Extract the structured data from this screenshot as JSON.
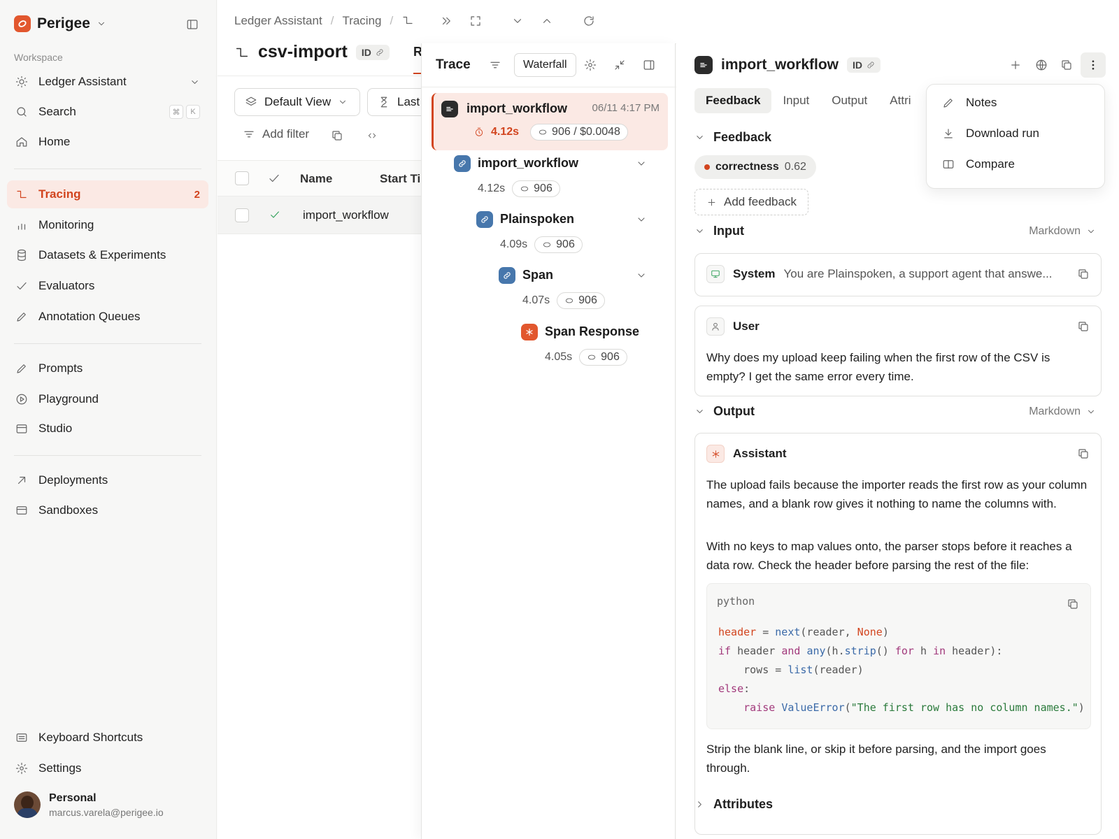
{
  "sidebar": {
    "brand": "Perigee",
    "workspace_label": "Workspace",
    "workspace_name": "Ledger Assistant",
    "search": "Search",
    "kbd": [
      "⌘",
      "K"
    ],
    "home": "Home",
    "tracing": "Tracing",
    "tracing_count": "2",
    "monitoring": "Monitoring",
    "datasets": "Datasets & Experiments",
    "evaluators": "Evaluators",
    "annotation": "Annotation Queues",
    "prompts": "Prompts",
    "playground": "Playground",
    "studio": "Studio",
    "deployments": "Deployments",
    "sandboxes": "Sandboxes",
    "shortcuts": "Keyboard Shortcuts",
    "settings": "Settings",
    "user_name": "Personal",
    "user_email": "marcus.varela@perigee.io"
  },
  "list": {
    "crumb1": "Ledger Assistant",
    "crumb2": "Tracing",
    "sep": "/",
    "project": "csv-import",
    "id_label": "ID",
    "tab_partial": "R",
    "view": "Default View",
    "last": "Last",
    "add_filter": "Add filter",
    "col_name": "Name",
    "col_start": "Start Ti",
    "row_name": "import_workflow"
  },
  "trace": {
    "title": "Trace",
    "waterfall": "Waterfall",
    "root": {
      "name": "import_workflow",
      "time": "06/11 4:17 PM",
      "latency": "4.12s",
      "tokens": "906 / $0.0048"
    },
    "nodes": [
      {
        "name": "import_workflow",
        "latency": "4.12s",
        "tokens": "906"
      },
      {
        "name": "Plainspoken",
        "latency": "4.09s",
        "tokens": "906"
      },
      {
        "name": "Span",
        "latency": "4.07s",
        "tokens": "906"
      },
      {
        "name": "Span Response",
        "latency": "4.05s",
        "tokens": "906"
      }
    ]
  },
  "detail": {
    "title": "import_workflow",
    "id_label": "ID",
    "tabs": [
      "Feedback",
      "Input",
      "Output",
      "Attri"
    ],
    "feedback_section": "Feedback",
    "feedback_key": "correctness",
    "feedback_score": "0.62",
    "add_feedback": "Add feedback",
    "input_section": "Input",
    "format": "Markdown",
    "system_role": "System",
    "system_text": "You are Plainspoken, a support agent that answe...",
    "user_role": "User",
    "user_text": "Why does my upload keep failing when the first row of the CSV is empty? I get the same error every time.",
    "output_section": "Output",
    "assistant_role": "Assistant",
    "assistant_p1": "The upload fails because the importer reads the first row as your column names, and a blank row gives it nothing to name the columns with.",
    "assistant_p2": "With no keys to map values onto, the parser stops before it reaches a data row. Check the header before parsing the rest of the file:",
    "code_lang": "python",
    "assistant_p3": "Strip the blank line, or skip it before parsing, and the import goes through.",
    "attributes_section": "Attributes"
  },
  "menu": {
    "notes": "Notes",
    "download": "Download run",
    "compare": "Compare"
  },
  "colors": {
    "accent": "#d2451f",
    "accent_bg": "#fbe9e4",
    "node_blue": "#3b6aa8"
  }
}
